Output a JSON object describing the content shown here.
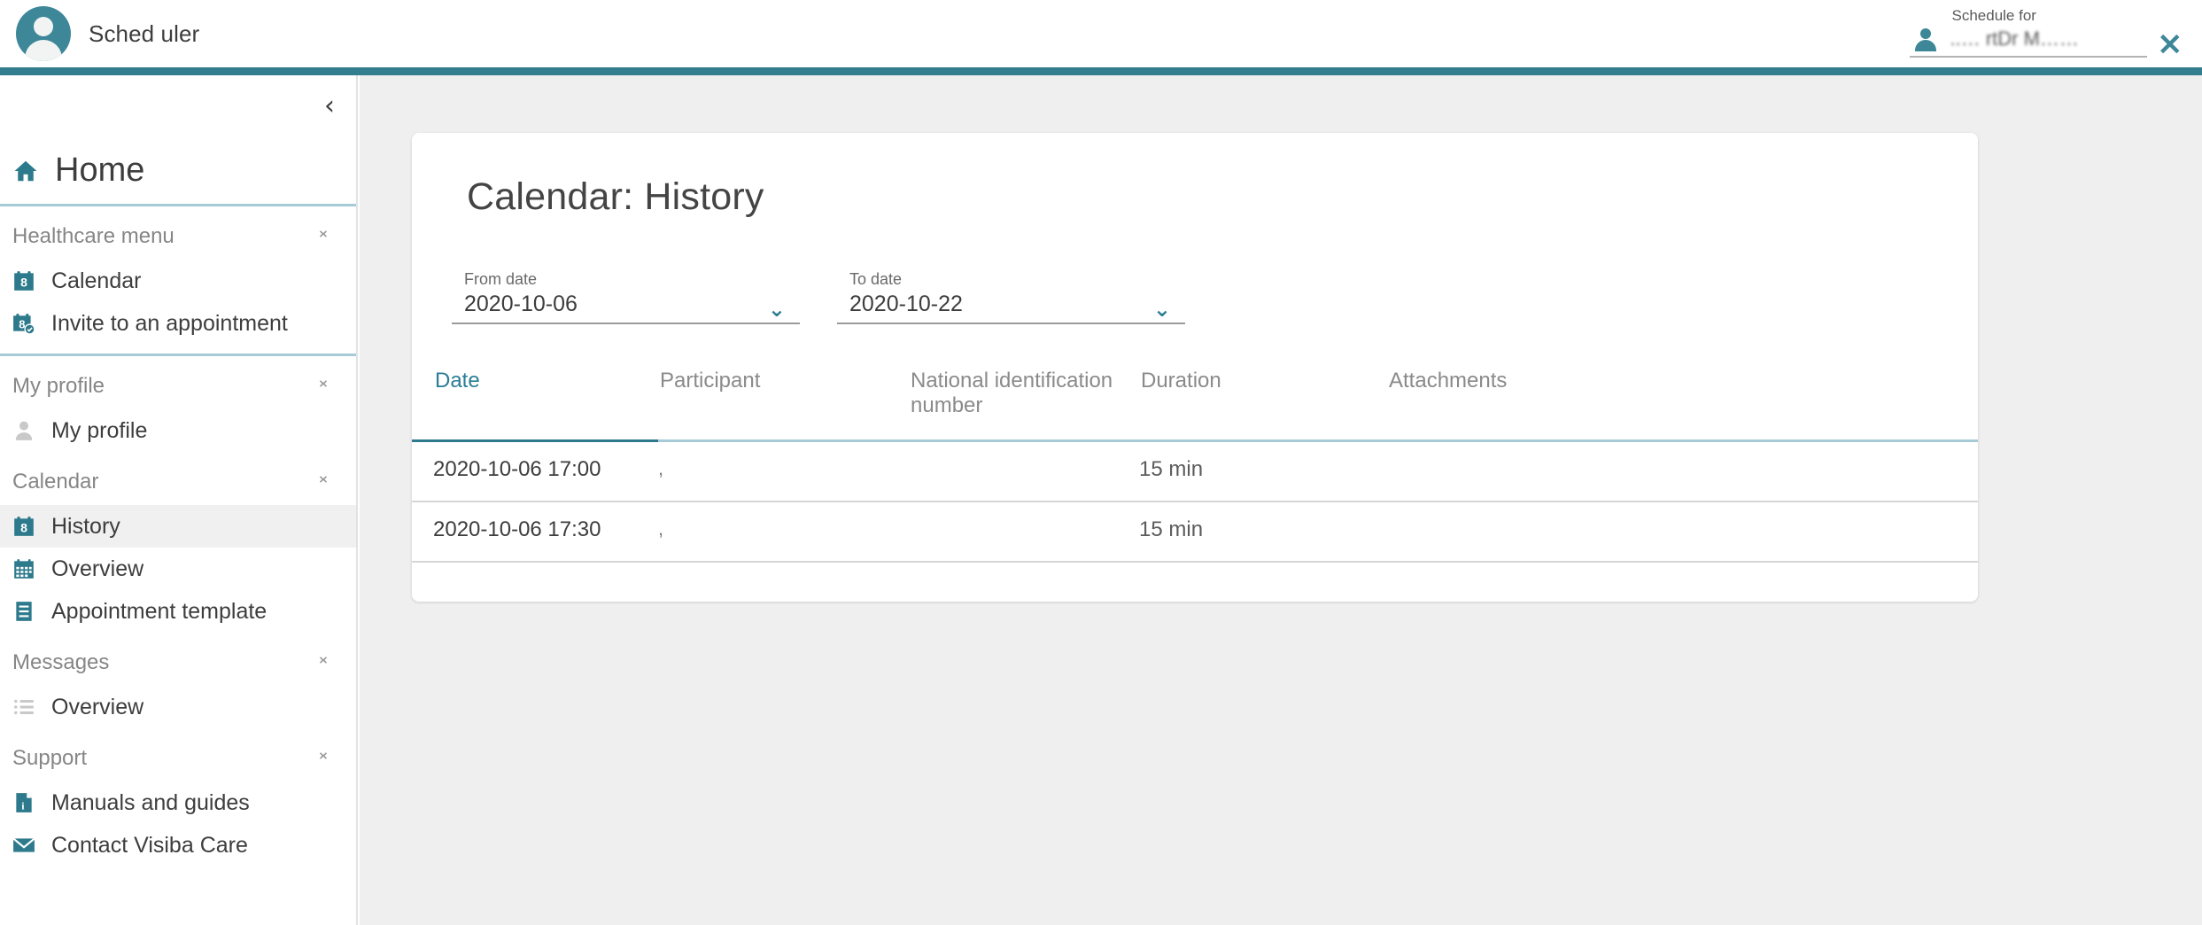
{
  "header": {
    "user_name": "Sched uler",
    "avatar_icon": "user-avatar-icon",
    "schedule_for_label": "Schedule for",
    "schedule_for_value": "..… rtDr M……",
    "person_icon": "person-icon",
    "close_icon": "✕"
  },
  "sidebar": {
    "collapse_icon": "‹",
    "home": {
      "label": "Home",
      "icon": "home-icon"
    },
    "groups": [
      {
        "title": "Healthcare menu",
        "toggle_icon": "collapse-expand-icon",
        "items": [
          {
            "label": "Calendar",
            "icon": "calendar-icon",
            "active": false
          },
          {
            "label": "Invite to an appointment",
            "icon": "calendar-check-icon",
            "active": false
          }
        ],
        "divider_after": true
      },
      {
        "title": "My profile",
        "toggle_icon": "collapse-expand-icon",
        "items": [
          {
            "label": "My profile",
            "icon": "person-icon",
            "active": false
          }
        ],
        "divider_after": false
      },
      {
        "title": "Calendar",
        "toggle_icon": "collapse-expand-icon",
        "items": [
          {
            "label": "History",
            "icon": "calendar-icon",
            "active": true
          },
          {
            "label": "Overview",
            "icon": "calendar-grid-icon",
            "active": false
          },
          {
            "label": "Appointment template",
            "icon": "document-lines-icon",
            "active": false
          }
        ],
        "divider_after": false
      },
      {
        "title": "Messages",
        "toggle_icon": "collapse-expand-icon",
        "items": [
          {
            "label": "Overview",
            "icon": "list-icon",
            "active": false
          }
        ],
        "divider_after": false
      },
      {
        "title": "Support",
        "toggle_icon": "collapse-expand-icon",
        "items": [
          {
            "label": "Manuals and guides",
            "icon": "document-info-icon",
            "active": false
          },
          {
            "label": "Contact Visiba Care",
            "icon": "envelope-icon",
            "active": false
          }
        ],
        "divider_after": false
      }
    ]
  },
  "main": {
    "card_title": "Calendar: History",
    "filters": {
      "from": {
        "label": "From date",
        "value": "2020-10-06",
        "chevron": "⌄"
      },
      "to": {
        "label": "To date",
        "value": "2020-10-22",
        "chevron": "⌄"
      }
    },
    "table": {
      "columns": [
        {
          "key": "date",
          "label": "Date",
          "active": true
        },
        {
          "key": "participant",
          "label": "Participant",
          "active": false
        },
        {
          "key": "nid",
          "label": "National identification number",
          "active": false
        },
        {
          "key": "duration",
          "label": "Duration",
          "active": false
        },
        {
          "key": "attachments",
          "label": "Attachments",
          "active": false
        }
      ],
      "rows": [
        {
          "date": "2020-10-06 17:00",
          "participant": ",",
          "nid": "",
          "duration": "15 min",
          "attachments": ""
        },
        {
          "date": "2020-10-06 17:30",
          "participant": ",",
          "nid": "",
          "duration": "15 min",
          "attachments": ""
        }
      ]
    }
  },
  "colors": {
    "teal": "#327d8e",
    "teal_light": "#a7cbd6",
    "accent_icon": "#2d7a8c",
    "page_bg": "#efefef",
    "text": "#3d3d3d",
    "muted": "#868686"
  }
}
